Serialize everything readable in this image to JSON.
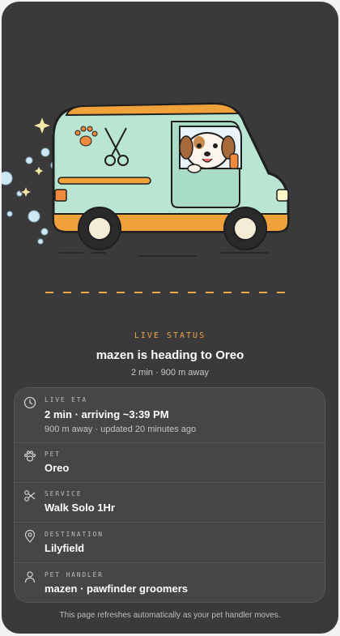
{
  "status": {
    "label": "LIVE STATUS",
    "title": "mazen is heading to Oreo",
    "subtitle": "2 min · 900 m away"
  },
  "details": [
    {
      "icon": "clock-icon",
      "label": "LIVE ETA",
      "value": "2 min · arriving ~3:39 PM",
      "sub": "900 m away · updated 20 minutes ago"
    },
    {
      "icon": "paw-icon",
      "label": "PET",
      "value": "Oreo"
    },
    {
      "icon": "scissors-icon",
      "label": "SERVICE",
      "value": "Walk Solo 1Hr"
    },
    {
      "icon": "location-pin-icon",
      "label": "DESTINATION",
      "value": "Lilyfield"
    },
    {
      "icon": "person-icon",
      "label": "PET HANDLER",
      "value": "mazen · pawfinder groomers"
    }
  ],
  "footer": "This page refreshes automatically as your pet handler moves.",
  "colors": {
    "background": "#3a3a3a",
    "accent": "#e8a648",
    "van_body": "#b8e6d3",
    "van_roof": "#f0a23a"
  }
}
